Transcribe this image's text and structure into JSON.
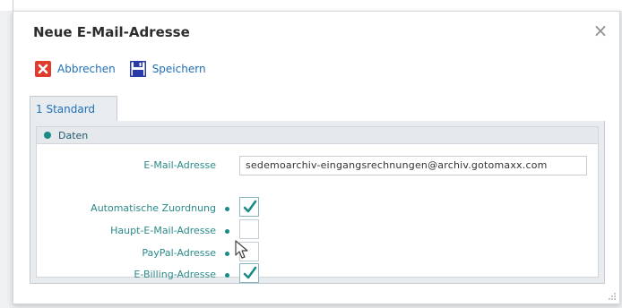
{
  "dialog": {
    "title": "Neue E-Mail-Adresse",
    "close_symbol": "×"
  },
  "toolbar": {
    "cancel": {
      "label": "Abbrechen",
      "icon": "cancel-x-icon"
    },
    "save": {
      "label": "Speichern",
      "icon": "floppy-disk-icon"
    }
  },
  "tabs": [
    {
      "label": "1 Standard",
      "active": true
    }
  ],
  "group": {
    "label": "Daten"
  },
  "fields": {
    "email": {
      "label": "E-Mail-Adresse",
      "value": "sedemoarchiv-eingangsrechnungen@archiv.gotomaxx.com"
    },
    "auto_assign": {
      "label": "Automatische Zuordnung",
      "checked": true
    },
    "main_email": {
      "label": "Haupt-E-Mail-Adresse",
      "checked": false
    },
    "paypal": {
      "label": "PayPal-Adresse",
      "checked": false
    },
    "ebilling": {
      "label": "E-Billing-Adresse",
      "checked": true
    }
  },
  "colors": {
    "accent_teal": "#1a8b86",
    "link_blue": "#1e6fb8",
    "cancel_red": "#e03c2e",
    "save_blue": "#2a3aa8"
  }
}
